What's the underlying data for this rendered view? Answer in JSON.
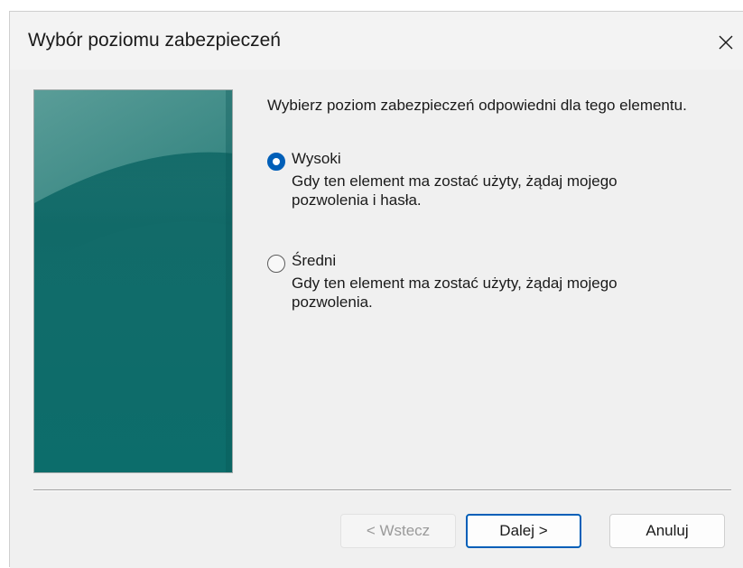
{
  "window": {
    "title": "Wybór poziomu zabezpieczeń",
    "close_icon": "close-icon"
  },
  "content": {
    "prompt": "Wybierz poziom zabezpieczeń odpowiedni dla tego elementu.",
    "options": [
      {
        "label": "Wysoki",
        "description": "Gdy ten element ma zostać użyty, żądaj mojego pozwolenia i hasła.",
        "selected": true
      },
      {
        "label": "Średni",
        "description": "Gdy ten element ma zostać użyty, żądaj mojego pozwolenia.",
        "selected": false
      }
    ]
  },
  "buttons": {
    "back_label": "< Wstecz",
    "back_enabled": false,
    "next_label": "Dalej >",
    "cancel_label": "Anuluj"
  },
  "colors": {
    "accent": "#005fb8",
    "side_image_teal": "#0f6f6c",
    "dialog_background": "#f0f0f0"
  }
}
